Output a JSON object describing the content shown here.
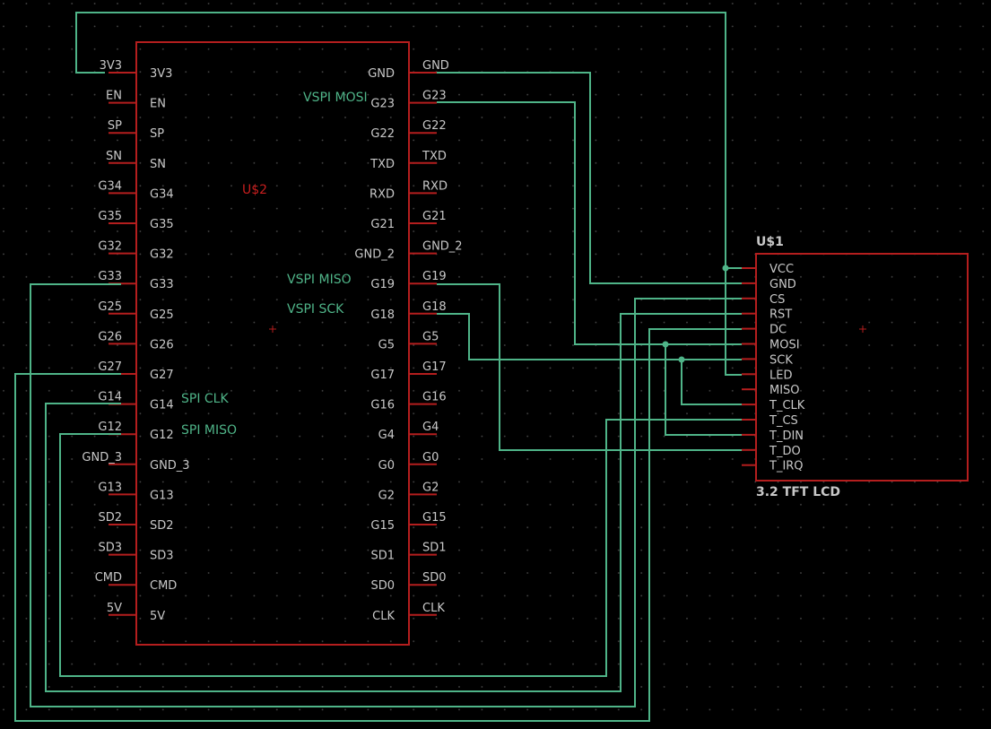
{
  "colors": {
    "background": "#000000",
    "grid_dot": "#4a4a4a",
    "part_outline": "#b41e1e",
    "wire": "#4fb488",
    "pin_text": "#c8c8c8",
    "part_ref": "#c81e1e"
  },
  "esp32": {
    "ref": "U$2",
    "left_pins": [
      {
        "net": "3V3",
        "name": "3V3"
      },
      {
        "net": "EN",
        "name": "EN"
      },
      {
        "net": "SP",
        "name": "SP"
      },
      {
        "net": "SN",
        "name": "SN"
      },
      {
        "net": "G34",
        "name": "G34"
      },
      {
        "net": "G35",
        "name": "G35"
      },
      {
        "net": "G32",
        "name": "G32"
      },
      {
        "net": "G33",
        "name": "G33"
      },
      {
        "net": "G25",
        "name": "G25"
      },
      {
        "net": "G26",
        "name": "G26"
      },
      {
        "net": "G27",
        "name": "G27"
      },
      {
        "net": "G14",
        "name": "G14"
      },
      {
        "net": "G12",
        "name": "G12"
      },
      {
        "net": "GND_3",
        "name": "GND_3"
      },
      {
        "net": "G13",
        "name": "G13"
      },
      {
        "net": "SD2",
        "name": "SD2"
      },
      {
        "net": "SD3",
        "name": "SD3"
      },
      {
        "net": "CMD",
        "name": "CMD"
      },
      {
        "net": "5V",
        "name": "5V"
      }
    ],
    "right_pins": [
      {
        "net": "GND",
        "name": "GND"
      },
      {
        "net": "G23",
        "name": "G23"
      },
      {
        "net": "G22",
        "name": "G22"
      },
      {
        "net": "TXD",
        "name": "TXD"
      },
      {
        "net": "RXD",
        "name": "RXD"
      },
      {
        "net": "G21",
        "name": "G21"
      },
      {
        "net": "GND_2",
        "name": "GND_2"
      },
      {
        "net": "G19",
        "name": "G19"
      },
      {
        "net": "G18",
        "name": "G18"
      },
      {
        "net": "G5",
        "name": "G5"
      },
      {
        "net": "G17",
        "name": "G17"
      },
      {
        "net": "G16",
        "name": "G16"
      },
      {
        "net": "G4",
        "name": "G4"
      },
      {
        "net": "G0",
        "name": "G0"
      },
      {
        "net": "G2",
        "name": "G2"
      },
      {
        "net": "G15",
        "name": "G15"
      },
      {
        "net": "SD1",
        "name": "SD1"
      },
      {
        "net": "SD0",
        "name": "SD0"
      },
      {
        "net": "CLK",
        "name": "CLK"
      }
    ],
    "net_labels": {
      "vspi_mosi": "VSPI MOSI",
      "vspi_miso": "VSPI MISO",
      "vspi_sck": "VSPI SCK",
      "spi_clk": "SPI CLK",
      "spi_miso": "SPI MISO"
    }
  },
  "lcd": {
    "ref": "U$1",
    "value": "3.2 TFT LCD",
    "pins": [
      "VCC",
      "GND",
      "CS",
      "RST",
      "DC",
      "MOSI",
      "SCK",
      "LED",
      "MISO",
      "T_CLK",
      "T_CS",
      "T_DIN",
      "T_DO",
      "T_IRQ"
    ]
  }
}
